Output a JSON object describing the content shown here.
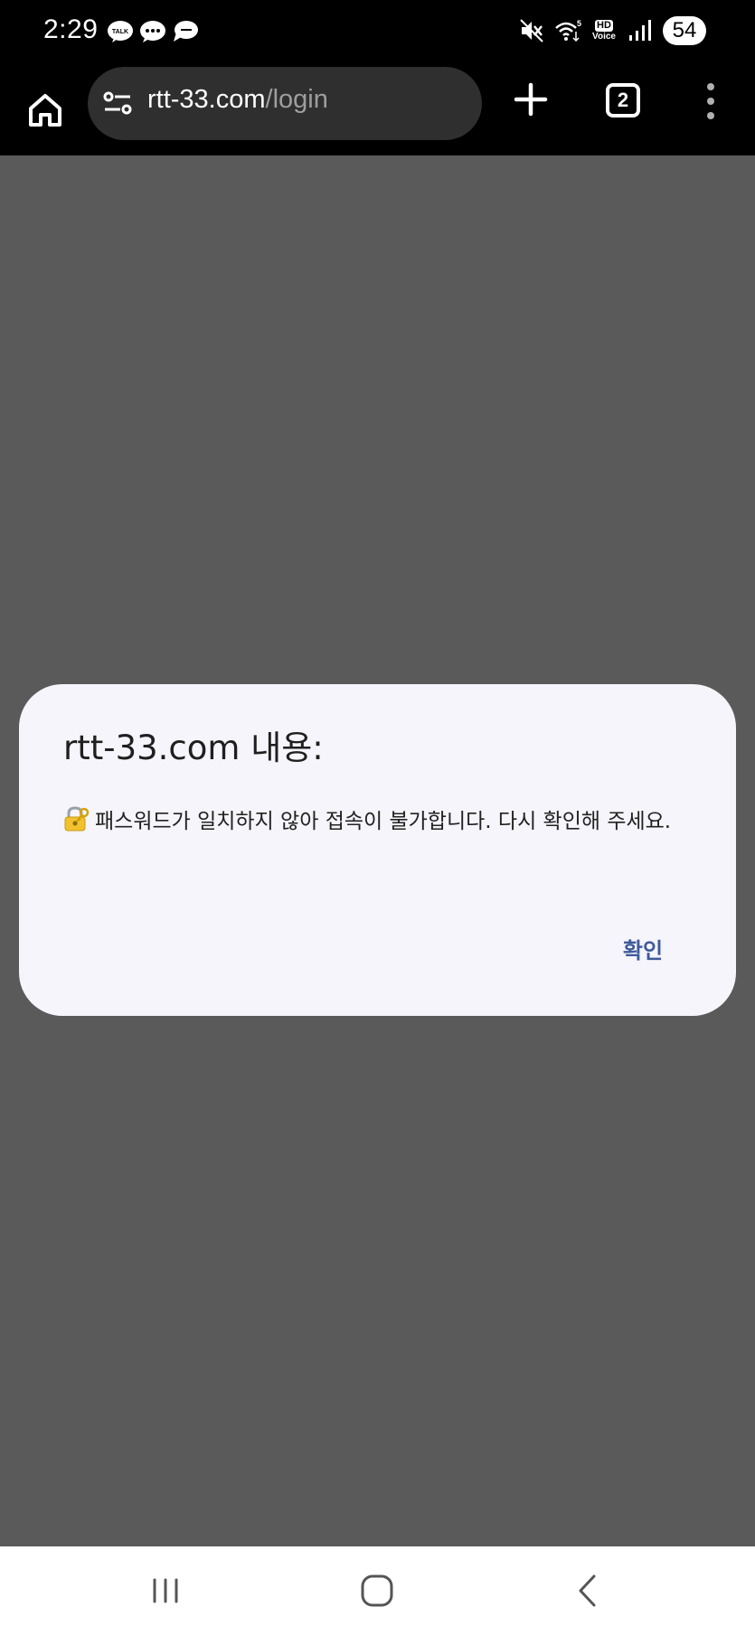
{
  "status_bar": {
    "time": "2:29",
    "notification_icons": [
      "kakaotalk-icon",
      "message-icon",
      "chat-bubble-icon"
    ],
    "status_icons": [
      "mute-icon",
      "wifi-icon",
      "hd-voice-icon",
      "signal-icon"
    ],
    "hd_label": "HD",
    "voice_label": "Voice",
    "battery": "54"
  },
  "browser": {
    "url_domain": "rtt-33.com",
    "url_path": "/login",
    "tab_count": "2"
  },
  "dialog": {
    "title": "rtt-33.com 내용:",
    "message": "패스워드가 일치하지 않아 접속이 불가합니다. 다시 확인해 주세요.",
    "confirm_label": "확인"
  },
  "colors": {
    "page_overlay": "#5a5a5a",
    "dialog_bg": "#f5f5fb",
    "confirm_text": "#3f5a9a"
  }
}
